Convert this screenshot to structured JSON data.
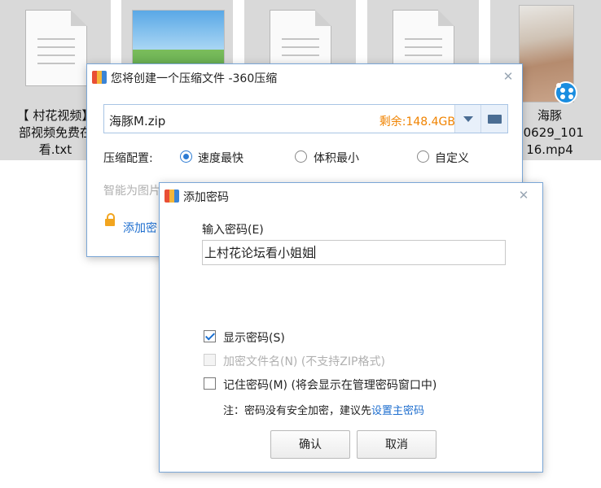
{
  "desktop": {
    "files": [
      {
        "caption_lines": [
          "【 村花视频】",
          "部视频免费在",
          "看.txt"
        ],
        "icon": "text-file-icon"
      },
      {
        "caption_lines": [],
        "icon": "image-file-icon"
      },
      {
        "caption_lines": [],
        "icon": "text-file-icon"
      },
      {
        "caption_lines": [],
        "icon": "text-file-icon"
      },
      {
        "caption_lines": [
          "海豚",
          "10629_101",
          "16.mp4"
        ],
        "icon": "video-file-icon"
      }
    ]
  },
  "create_dialog": {
    "title": "您将创建一个压缩文件 -360压缩",
    "close_glyph": "✕",
    "path_value": "海豚M.zip",
    "free_space": "剩余:148.4GB",
    "config_label": "压缩配置:",
    "options": [
      {
        "label": "速度最快",
        "selected": true
      },
      {
        "label": "体积最小",
        "selected": false
      },
      {
        "label": "自定义",
        "selected": false
      }
    ],
    "smart_hint": "智能为图片",
    "add_password_link": "添加密"
  },
  "password_dialog": {
    "title": "添加密码",
    "close_glyph": "✕",
    "input_label": "输入密码(E)",
    "password_value": "上村花论坛看小姐姐",
    "show_password": {
      "label": "显示密码(S)",
      "checked": true
    },
    "encrypt_names": {
      "label": "加密文件名(N) (不支持ZIP格式)",
      "checked": false,
      "disabled": true
    },
    "remember_password": {
      "label": "记住密码(M) (将会显示在管理密码窗口中)",
      "checked": false
    },
    "note_prefix": "注：密码没有安全加密，建议先",
    "note_link": "设置主密码",
    "ok_label": "确认",
    "cancel_label": "取消"
  },
  "colors": {
    "accent": "#2d7bd3",
    "free_space": "#f08300",
    "link": "#1f6fcf",
    "tile_bg": "#d9d9d9"
  }
}
